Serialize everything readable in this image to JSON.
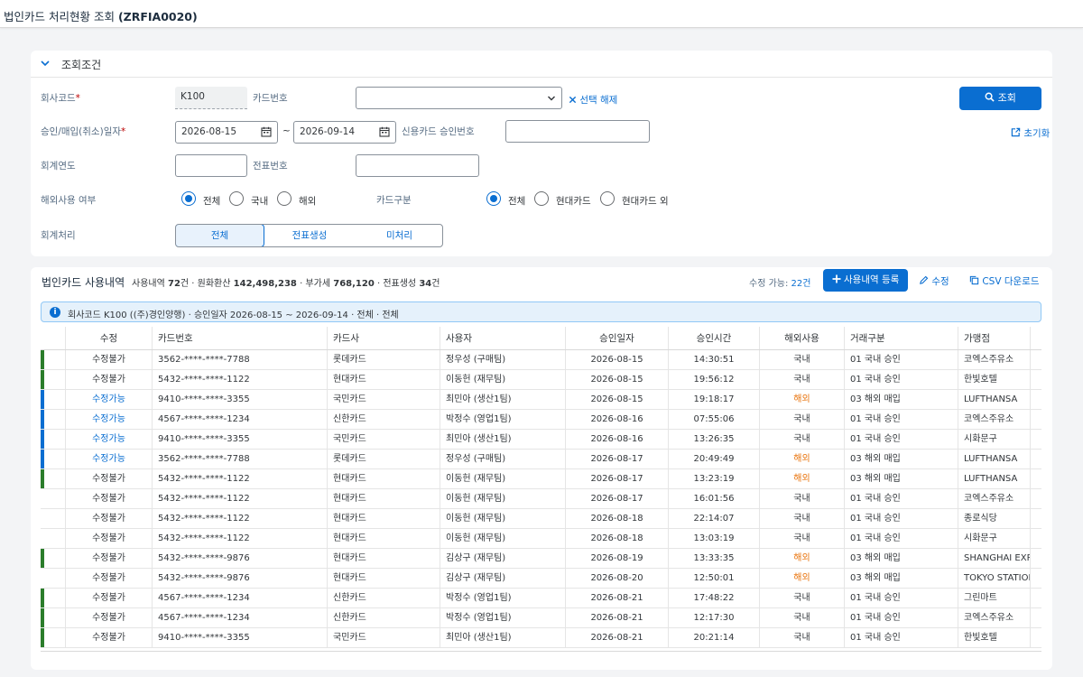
{
  "app": {
    "title": "법인카드 처리현황 조회",
    "code": "(ZRFIA0020)"
  },
  "filters": {
    "section_title": "조회조건",
    "company_code": {
      "label": "회사코드",
      "value": "K100"
    },
    "card_no": {
      "label": "카드번호",
      "value": ""
    },
    "clear_selection": "선택 해제",
    "search_button": "조회",
    "reset_button": "초기화",
    "approval_date": {
      "label": "승인/매입(취소)일자",
      "from": "2026-08-15",
      "to": "2026-09-14",
      "sep": "~"
    },
    "approval_no": {
      "label": "신용카드 승인번호",
      "value": ""
    },
    "fiscal_year": {
      "label": "회계연도",
      "value": ""
    },
    "slip_no": {
      "label": "전표번호",
      "value": ""
    },
    "overseas": {
      "label": "해외사용 여부",
      "options": [
        "전체",
        "국내",
        "해외"
      ],
      "selected": "전체"
    },
    "card_type": {
      "label": "카드구분",
      "options": [
        "전체",
        "현대카드",
        "현대카드 외"
      ],
      "selected": "전체"
    },
    "accounting": {
      "label": "회계처리",
      "options": [
        "전체",
        "전표생성",
        "미처리"
      ],
      "selected": "전체"
    }
  },
  "list": {
    "title": "법인카드 사용내역",
    "summary": {
      "count_label": "사용내역",
      "count": "72",
      "count_unit": "건 · 원화환산",
      "krw_total": "142,498,238",
      "vat_label": "· 부가세",
      "vat": "768,120",
      "slip_label": "· 전표생성",
      "slip": "34",
      "slip_unit": "건"
    },
    "editable_count_label": "수정 가능:",
    "editable_count": "22건",
    "register_button": "사용내역 등록",
    "edit_button": "수정",
    "csv_button": "CSV 다운로드",
    "info_text": "회사코드 K100 ((주)경인양행) · 승인일자 2026-08-15 ~ 2026-09-14 · 전체 · 전체",
    "columns": [
      "수정",
      "카드번호",
      "카드사",
      "사용자",
      "승인일자",
      "승인시간",
      "해외사용",
      "거래구분",
      "가맹점"
    ],
    "rows": [
      {
        "status": "수정불가",
        "card": "3562-****-****-7788",
        "company": "롯데카드",
        "user": "정우성 (구매팀)",
        "date": "2026-08-15",
        "time": "14:30:51",
        "region": "국내",
        "type": "01 국내 승인",
        "merchant": "코엑스주유소",
        "indicator": "green"
      },
      {
        "status": "수정불가",
        "card": "5432-****-****-1122",
        "company": "현대카드",
        "user": "이동헌 (재무팀)",
        "date": "2026-08-15",
        "time": "19:56:12",
        "region": "국내",
        "type": "01 국내 승인",
        "merchant": "한빛호텔",
        "indicator": "green"
      },
      {
        "status": "수정가능",
        "card": "9410-****-****-3355",
        "company": "국민카드",
        "user": "최민아 (생산1팀)",
        "date": "2026-08-15",
        "time": "19:18:17",
        "region": "해외",
        "type": "03 해외 매입",
        "merchant": "LUFTHANSA",
        "indicator": "blue"
      },
      {
        "status": "수정가능",
        "card": "4567-****-****-1234",
        "company": "신한카드",
        "user": "박정수 (영업1팀)",
        "date": "2026-08-16",
        "time": "07:55:06",
        "region": "국내",
        "type": "01 국내 승인",
        "merchant": "코엑스주유소",
        "indicator": "blue"
      },
      {
        "status": "수정가능",
        "card": "9410-****-****-3355",
        "company": "국민카드",
        "user": "최민아 (생산1팀)",
        "date": "2026-08-16",
        "time": "13:26:35",
        "region": "국내",
        "type": "01 국내 승인",
        "merchant": "시화문구",
        "indicator": "blue"
      },
      {
        "status": "수정가능",
        "card": "3562-****-****-7788",
        "company": "롯데카드",
        "user": "정우성 (구매팀)",
        "date": "2026-08-17",
        "time": "20:49:49",
        "region": "해외",
        "type": "03 해외 매입",
        "merchant": "LUFTHANSA",
        "indicator": "blue"
      },
      {
        "status": "수정불가",
        "card": "5432-****-****-1122",
        "company": "현대카드",
        "user": "이동헌 (재무팀)",
        "date": "2026-08-17",
        "time": "13:23:19",
        "region": "해외",
        "type": "03 해외 매입",
        "merchant": "LUFTHANSA",
        "indicator": "green"
      },
      {
        "status": "수정불가",
        "card": "5432-****-****-1122",
        "company": "현대카드",
        "user": "이동헌 (재무팀)",
        "date": "2026-08-17",
        "time": "16:01:56",
        "region": "국내",
        "type": "01 국내 승인",
        "merchant": "코엑스주유소",
        "indicator": "none"
      },
      {
        "status": "수정불가",
        "card": "5432-****-****-1122",
        "company": "현대카드",
        "user": "이동헌 (재무팀)",
        "date": "2026-08-18",
        "time": "22:14:07",
        "region": "국내",
        "type": "01 국내 승인",
        "merchant": "종로식당",
        "indicator": "none"
      },
      {
        "status": "수정불가",
        "card": "5432-****-****-1122",
        "company": "현대카드",
        "user": "이동헌 (재무팀)",
        "date": "2026-08-18",
        "time": "13:03:19",
        "region": "국내",
        "type": "01 국내 승인",
        "merchant": "시화문구",
        "indicator": "none"
      },
      {
        "status": "수정불가",
        "card": "5432-****-****-9876",
        "company": "현대카드",
        "user": "김상구 (재무팀)",
        "date": "2026-08-19",
        "time": "13:33:35",
        "region": "해외",
        "type": "03 해외 매입",
        "merchant": "SHANGHAI EXPO",
        "indicator": "green"
      },
      {
        "status": "수정불가",
        "card": "5432-****-****-9876",
        "company": "현대카드",
        "user": "김상구 (재무팀)",
        "date": "2026-08-20",
        "time": "12:50:01",
        "region": "해외",
        "type": "03 해외 매입",
        "merchant": "TOKYO STATION",
        "indicator": "none"
      },
      {
        "status": "수정불가",
        "card": "4567-****-****-1234",
        "company": "신한카드",
        "user": "박정수 (영업1팀)",
        "date": "2026-08-21",
        "time": "17:48:22",
        "region": "국내",
        "type": "01 국내 승인",
        "merchant": "그린마트",
        "indicator": "green"
      },
      {
        "status": "수정불가",
        "card": "4567-****-****-1234",
        "company": "신한카드",
        "user": "박정수 (영업1팀)",
        "date": "2026-08-21",
        "time": "12:17:30",
        "region": "국내",
        "type": "01 국내 승인",
        "merchant": "코엑스주유소",
        "indicator": "green"
      },
      {
        "status": "수정불가",
        "card": "9410-****-****-3355",
        "company": "국민카드",
        "user": "최민아 (생산1팀)",
        "date": "2026-08-21",
        "time": "20:21:14",
        "region": "국내",
        "type": "01 국내 승인",
        "merchant": "한빛호텔",
        "indicator": "green"
      }
    ]
  },
  "colors": {
    "accent": "#0a6ed1",
    "indicator_green": "#2b7d2b",
    "indicator_blue": "#0a6ed1",
    "overseas": "#e9730c"
  }
}
